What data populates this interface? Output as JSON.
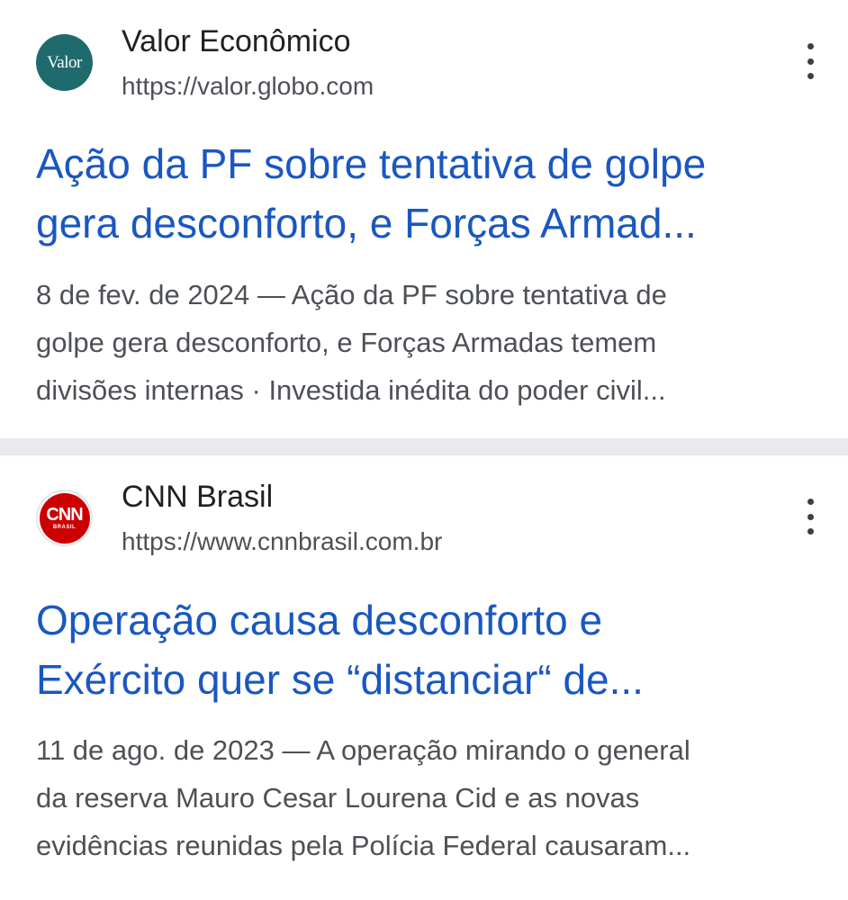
{
  "results": [
    {
      "site_name": "Valor Econômico",
      "url": "https://valor.globo.com",
      "favicon": {
        "icon": "valor-logo-icon",
        "text": "Valor",
        "color": "#1f6a6d"
      },
      "title_lines": [
        "Ação da PF sobre tentativa de golpe",
        "gera desconforto, e Forças Armad..."
      ],
      "snippet_lines": [
        "8 de fev. de 2024 — Ação da PF sobre tentativa de",
        "golpe gera desconforto, e Forças Armadas temem",
        "divisões internas · Investida inédita do poder civil..."
      ]
    },
    {
      "site_name": "CNN Brasil",
      "url": "https://www.cnnbrasil.com.br",
      "favicon": {
        "icon": "cnn-brasil-logo-icon",
        "text": "CNN",
        "subtext": "BRASIL",
        "color": "#cc0000"
      },
      "title_lines": [
        "Operação causa desconforto e",
        "Exército quer se “distanciar“ de..."
      ],
      "snippet_lines": [
        "11 de ago. de 2023 — A operação mirando o general",
        "da reserva Mauro Cesar Lourena Cid e as novas",
        "evidências reunidas pela Polícia Federal causaram..."
      ]
    }
  ],
  "colors": {
    "title_link": "#1a57c1",
    "text_primary": "#202124",
    "text_secondary": "#4d5156",
    "divider": "#e8eaed"
  }
}
